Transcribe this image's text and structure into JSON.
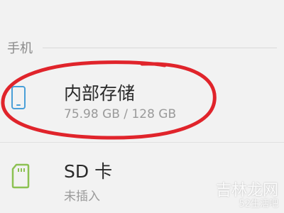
{
  "section": {
    "title": "手机"
  },
  "storage": {
    "internal": {
      "icon": "phone-icon",
      "title": "内部存储",
      "usage": "75.98 GB / 128 GB"
    },
    "sd": {
      "icon": "sd-card-icon",
      "title": "SD 卡",
      "status": "未插入"
    }
  },
  "annotation": {
    "color": "#e0242b"
  },
  "watermark": {
    "main": "吉林龙网",
    "sub": "52生活吧"
  },
  "colors": {
    "background": "#f2f2f2",
    "phone_icon": "#4a9fd8",
    "sd_icon": "#8cc152",
    "title_text": "#2a2a2a",
    "subtitle_text": "#9a9a9a"
  }
}
